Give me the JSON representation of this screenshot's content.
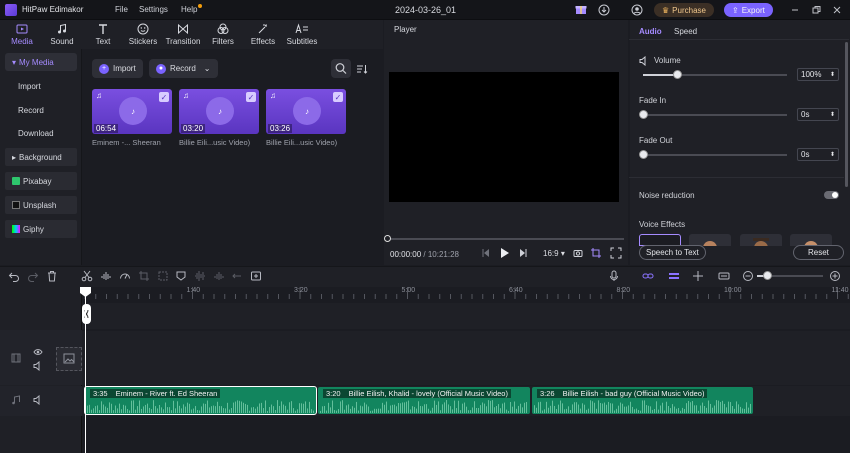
{
  "app": {
    "name": "HitPaw Edimakor",
    "document": "2024-03-26_01",
    "menu": [
      "File",
      "Settings",
      "Help"
    ],
    "purchase_label": "Purchase",
    "export_label": "Export",
    "accent": "#7a63ff"
  },
  "tools": [
    {
      "label": "Media",
      "icon": "media-icon"
    },
    {
      "label": "Sound",
      "icon": "music-note-icon"
    },
    {
      "label": "Text",
      "icon": "text-icon"
    },
    {
      "label": "Stickers",
      "icon": "sticker-icon"
    },
    {
      "label": "Transition",
      "icon": "transition-icon"
    },
    {
      "label": "Filters",
      "icon": "filters-icon"
    },
    {
      "label": "Effects",
      "icon": "effects-icon"
    },
    {
      "label": "Subtitles",
      "icon": "subtitles-icon"
    }
  ],
  "nav": {
    "my_media": "My Media",
    "import": "Import",
    "record": "Record",
    "download": "Download",
    "background": "Background",
    "pixabay": "Pixabay",
    "unsplash": "Unsplash",
    "giphy": "Giphy"
  },
  "media": {
    "import_label": "Import",
    "record_label": "Record",
    "items": [
      {
        "duration": "06:54",
        "name": "Eminem -... Sheeran"
      },
      {
        "duration": "03:20",
        "name": "Billie Eili...usic Video)"
      },
      {
        "duration": "03:26",
        "name": "Billie Eili...usic Video)"
      }
    ]
  },
  "player": {
    "label": "Player",
    "current": "00:00:00",
    "separator": "/",
    "total": "10:21:28",
    "ratio": "16:9"
  },
  "panel": {
    "tabs": [
      "Audio",
      "Speed"
    ],
    "volume_label": "Volume",
    "volume_value": "100%",
    "volume_level": 0.24,
    "fade_in_label": "Fade In",
    "fade_in_value": "0s",
    "fade_out_label": "Fade Out",
    "fade_out_value": "0s",
    "noise_label": "Noise reduction",
    "voice_label": "Voice Effects",
    "speech_label": "Speech to Text",
    "reset_label": "Reset"
  },
  "timeline": {
    "ticks": [
      "1:40",
      "3:20",
      "5:00",
      "6:40",
      "8:20",
      "10:00",
      "11:40"
    ],
    "clips": [
      {
        "duration": "3:35",
        "title": "Eminem - River ft. Ed Sheeran"
      },
      {
        "duration": "3:20",
        "title": "Billie Eilish, Khalid - lovely (Official Music Video)"
      },
      {
        "duration": "3:26",
        "title": "Billie Eilish - bad guy (Official Music Video)"
      }
    ],
    "clip_color": "#12855e"
  }
}
